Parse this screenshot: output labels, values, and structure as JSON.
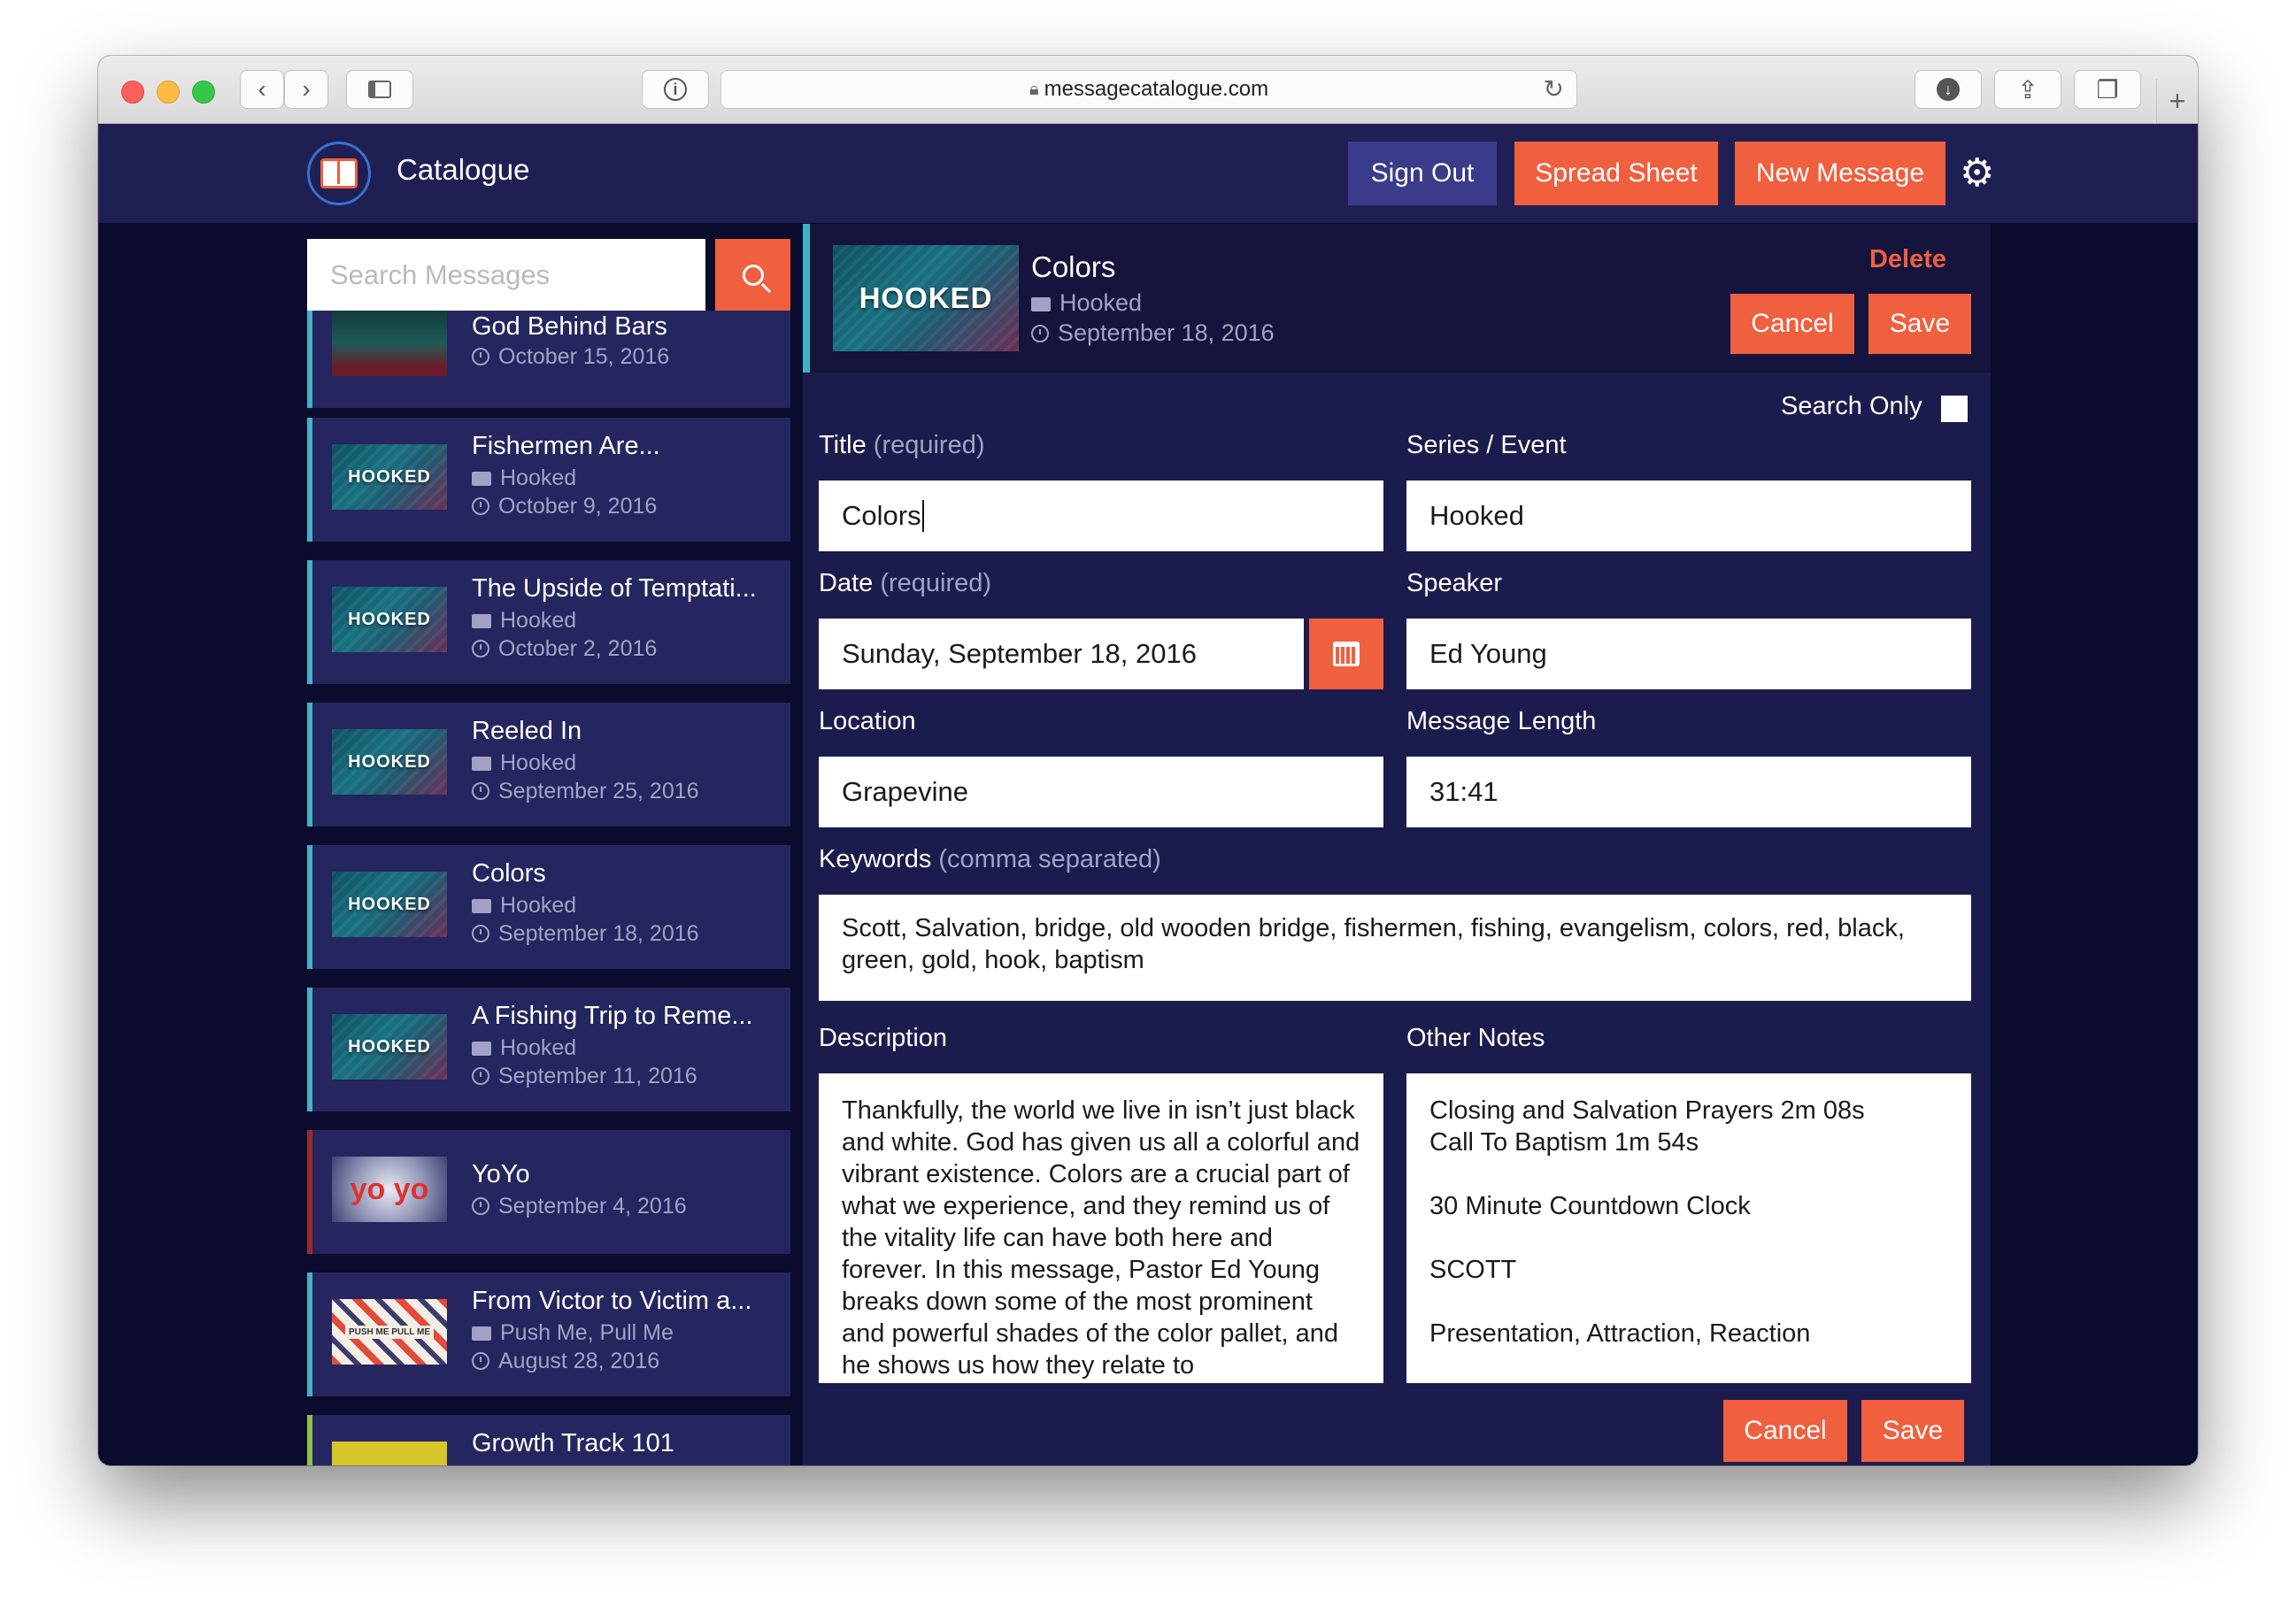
{
  "browser": {
    "url": "messagecatalogue.com"
  },
  "header": {
    "brand": "Catalogue",
    "sign_out": "Sign Out",
    "spread_sheet": "Spread Sheet",
    "new_message": "New Message"
  },
  "sidebar": {
    "search_placeholder": "Search Messages",
    "items": [
      {
        "title": "God Behind Bars",
        "series": "",
        "date": "October 15, 2016",
        "thumb": "god-behind-bars",
        "accent": "#3fb3c6"
      },
      {
        "title": "Fishermen Are...",
        "series": "Hooked",
        "date": "October 9, 2016",
        "thumb": "hooked",
        "accent": "#3fb3c6"
      },
      {
        "title": "The Upside of Temptati...",
        "series": "Hooked",
        "date": "October 2, 2016",
        "thumb": "hooked",
        "accent": "#3fb3c6"
      },
      {
        "title": "Reeled In",
        "series": "Hooked",
        "date": "September 25, 2016",
        "thumb": "hooked",
        "accent": "#3fb3c6"
      },
      {
        "title": "Colors",
        "series": "Hooked",
        "date": "September 18, 2016",
        "thumb": "hooked",
        "accent": "#3fb3c6"
      },
      {
        "title": "A Fishing Trip to Reme...",
        "series": "Hooked",
        "date": "September 11, 2016",
        "thumb": "hooked",
        "accent": "#3fb3c6"
      },
      {
        "title": "YoYo",
        "series": "",
        "date": "September 4, 2016",
        "thumb": "yoyo",
        "accent": "#9b2a2a"
      },
      {
        "title": "From Victor to Victim a...",
        "series": "Push Me, Pull Me",
        "date": "August 28, 2016",
        "thumb": "push-me-pull-me",
        "accent": "#3fb3c6"
      },
      {
        "title": "Growth Track 101",
        "series": "",
        "date": "",
        "thumb": "growth-track",
        "accent": "#8cc04a"
      }
    ],
    "thumb_text": {
      "hooked": "HOOKED",
      "yoyo": "yo yo",
      "push": "PUSH ME PULL ME"
    }
  },
  "detail": {
    "title": "Colors",
    "series": "Hooked",
    "date": "September 18, 2016",
    "delete": "Delete",
    "cancel": "Cancel",
    "save": "Save",
    "search_only": "Search Only",
    "search_only_checked": false,
    "fields": {
      "title_label": "Title",
      "title_hint": "(required)",
      "title_value": "Colors",
      "series_label": "Series / Event",
      "series_value": "Hooked",
      "date_label": "Date",
      "date_hint": "(required)",
      "date_value": "Sunday, September 18, 2016",
      "speaker_label": "Speaker",
      "speaker_value": "Ed Young",
      "location_label": "Location",
      "location_value": "Grapevine",
      "length_label": "Message Length",
      "length_value": "31:41",
      "keywords_label": "Keywords",
      "keywords_hint": "(comma separated)",
      "keywords_value": "Scott, Salvation, bridge, old wooden bridge, fishermen, fishing, evangelism, colors, red, black, green, gold, hook, baptism",
      "description_label": "Description",
      "description_value": "Thankfully, the world we live in isn’t just black and white. God has given us all a colorful and vibrant existence. Colors are a crucial part of what we experience, and they remind us of the vitality life can have both here and forever. In this message, Pastor Ed Young breaks down some of the most prominent and powerful shades of the color pallet, and he shows us how they relate to",
      "notes_label": "Other Notes",
      "notes_value": "Closing and Salvation Prayers 2m 08s\nCall To Baptism 1m 54s\n\n30 Minute Countdown Clock\n\nSCOTT\n\nPresentation, Attraction, Reaction"
    }
  },
  "colors": {
    "accent": "#f05f3e",
    "header_bg": "#1f1f54",
    "page_bg": "#0b0b2e",
    "item_bg": "#25255f",
    "teal": "#3fb3c6"
  }
}
